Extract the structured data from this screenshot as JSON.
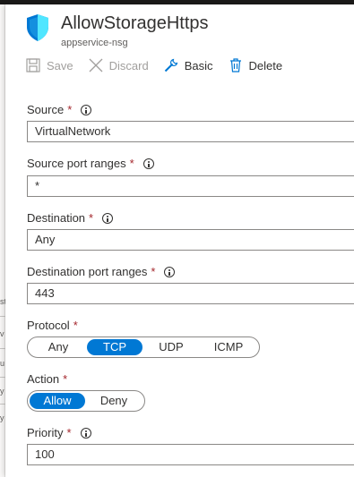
{
  "title": "AllowStorageHttps",
  "subtitle": "appservice-nsg",
  "toolbar": {
    "save": "Save",
    "discard": "Discard",
    "basic": "Basic",
    "delete": "Delete"
  },
  "required_marker": "*",
  "fields": {
    "source": {
      "label": "Source",
      "value": "VirtualNetwork"
    },
    "source_port_ranges": {
      "label": "Source port ranges",
      "value": "*"
    },
    "destination": {
      "label": "Destination",
      "value": "Any"
    },
    "destination_port_ranges": {
      "label": "Destination port ranges",
      "value": "443"
    },
    "protocol": {
      "label": "Protocol",
      "options": [
        "Any",
        "TCP",
        "UDP",
        "ICMP"
      ],
      "selected": "TCP"
    },
    "action": {
      "label": "Action",
      "options": [
        "Allow",
        "Deny"
      ],
      "selected": "Allow"
    },
    "priority": {
      "label": "Priority",
      "value": "100"
    }
  },
  "left_strip_fragments": [
    "st",
    "v",
    "u",
    "y",
    "y"
  ],
  "colors": {
    "accent": "#0078d4",
    "required": "#a4262c",
    "shield_dark": "#0078d4",
    "shield_light": "#50e6ff"
  },
  "icons": {
    "shield": "shield-icon",
    "save": "save-icon",
    "discard": "close-icon",
    "basic": "wrench-icon",
    "delete": "trash-icon",
    "info": "info-icon"
  }
}
